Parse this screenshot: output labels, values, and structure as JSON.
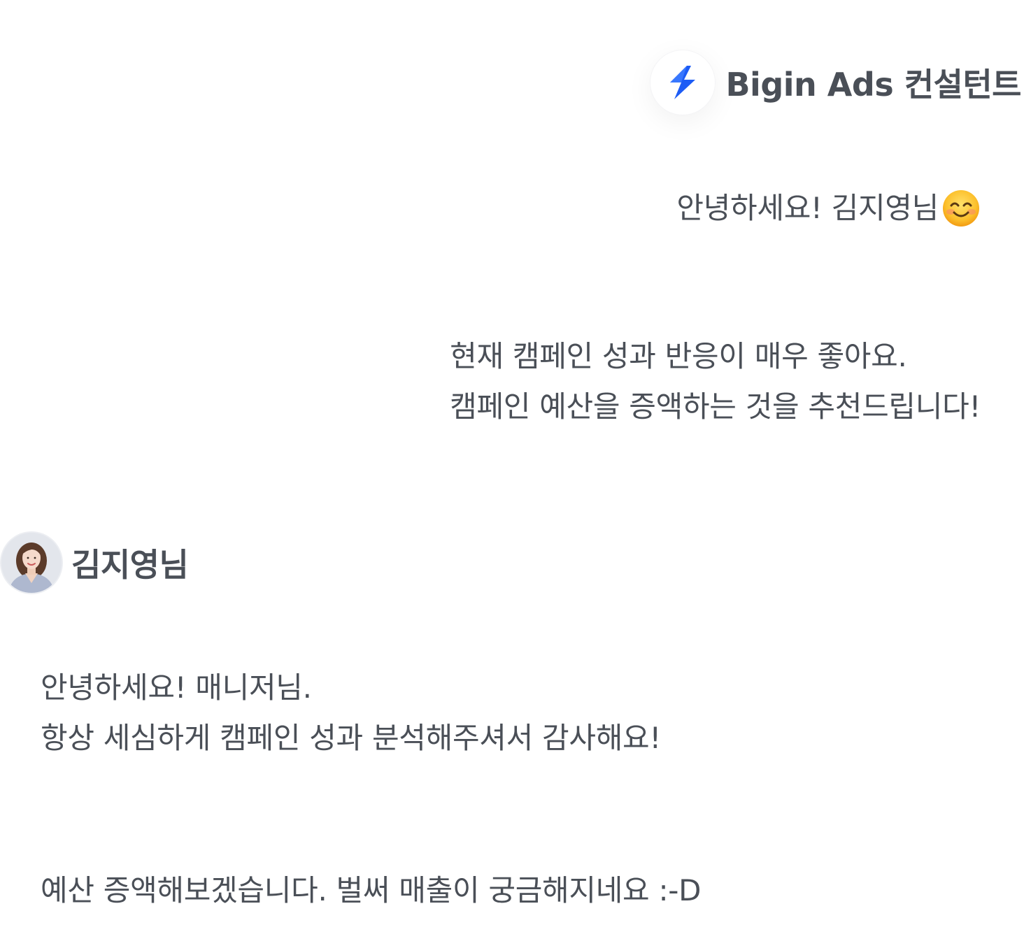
{
  "consultant": {
    "name": "Bigin Ads 컨설턴트",
    "avatar_icon": "bigin-lightning-logo-icon",
    "brand_color": "#1d5cf5",
    "messages": [
      {
        "lines": [
          "안녕하세요! 김지영님"
        ],
        "emoji": "smiling-face-emoji-icon"
      },
      {
        "lines": [
          "현재 캠페인 성과 반응이 매우 좋아요.",
          "캠페인 예산을 증액하는 것을 추천드립니다!"
        ]
      }
    ]
  },
  "customer": {
    "name": "김지영님",
    "avatar_icon": "user-avatar-photo",
    "messages": [
      {
        "lines": [
          "안녕하세요! 매니저님.",
          "항상 세심하게 캠페인 성과 분석해주셔서 감사해요!"
        ]
      },
      {
        "lines": [
          "예산 증액해보겠습니다. 벌써 매출이 궁금해지네요 :-D"
        ]
      }
    ]
  },
  "text_color": "#4a4f57"
}
